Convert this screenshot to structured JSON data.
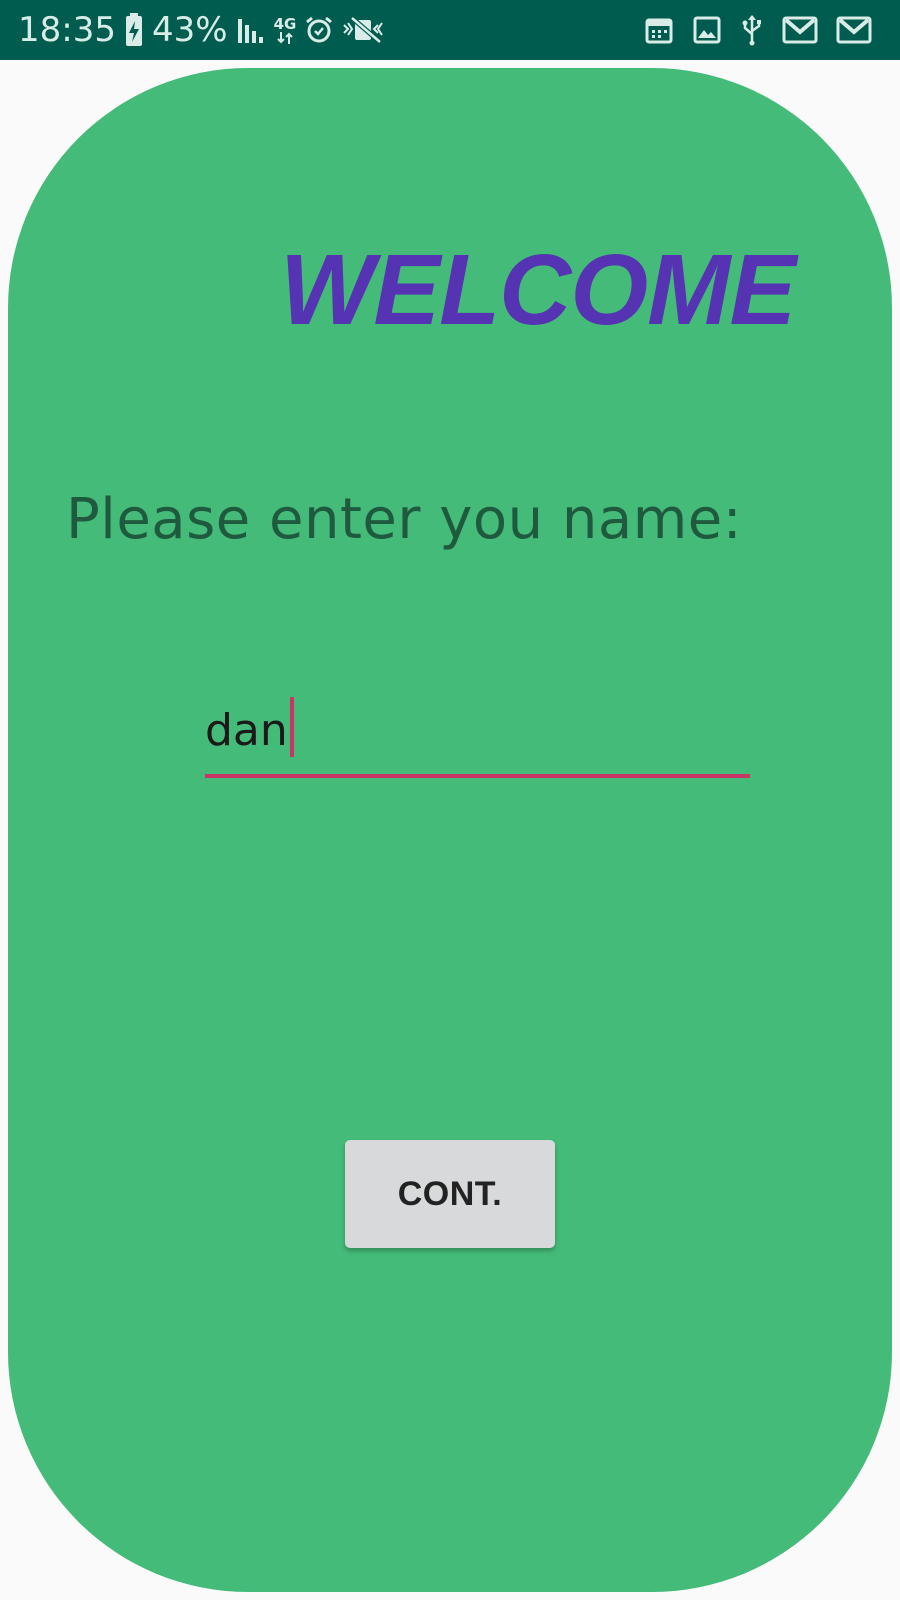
{
  "status_bar": {
    "time": "18:35",
    "battery_percent": "43%",
    "network": "4G",
    "icons_left": [
      "battery-charging-icon",
      "signal-icon",
      "network-4g-icon",
      "alarm-icon",
      "vibrate-silent-icon"
    ],
    "icons_right": [
      "calendar-icon",
      "image-icon",
      "usb-icon",
      "gmail-icon",
      "gmail-icon"
    ],
    "background_color": "#005c4f"
  },
  "screen": {
    "background_color": "#44bb79",
    "title": "WELCOME",
    "title_color": "#5533b2",
    "prompt": "Please enter you name:",
    "name_input": {
      "value": "dan",
      "accent_color": "#cc3366"
    },
    "continue_button": {
      "label": "CONT."
    }
  }
}
